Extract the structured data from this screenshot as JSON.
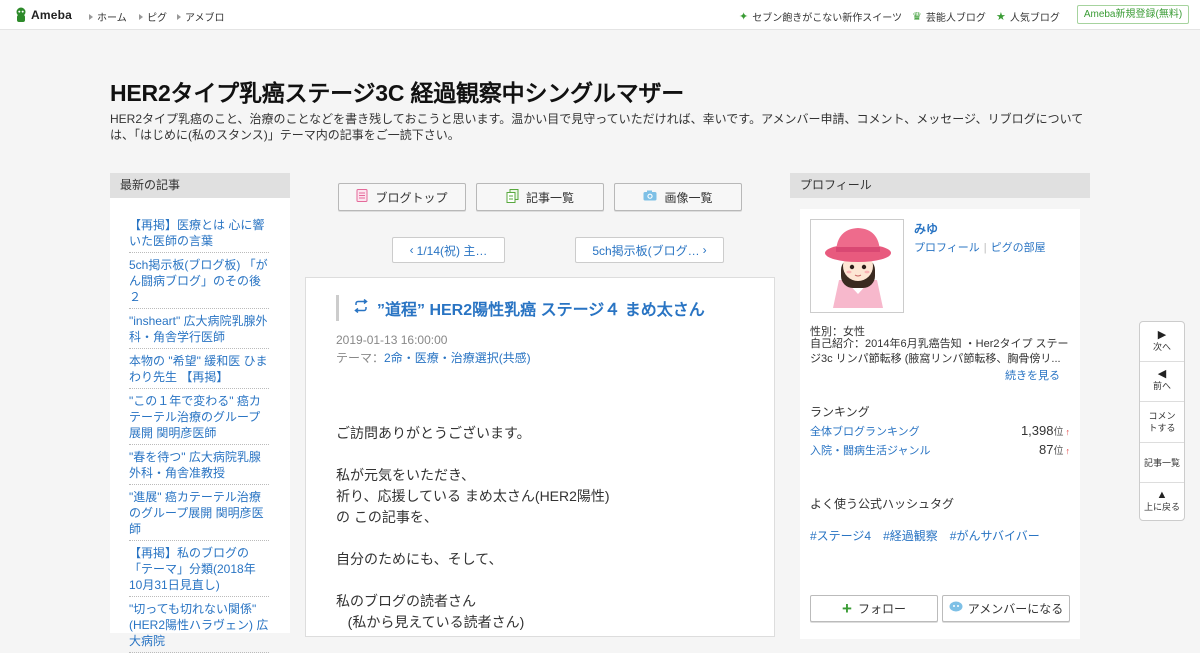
{
  "header": {
    "logo_text": "Ameba",
    "nav": [
      "ホーム",
      "ピグ",
      "アメブロ"
    ],
    "right_links": [
      {
        "icon": "sparkle-icon",
        "label": "セブン飽きがこない新作スイーツ"
      },
      {
        "icon": "crown-icon",
        "label": "芸能人ブログ"
      },
      {
        "icon": "star-icon",
        "label": "人気ブログ"
      }
    ],
    "signup_label": "Ameba新規登録(無料)"
  },
  "blog": {
    "title": "HER2タイプ乳癌ステージ3C 経過観察中シングルマザー",
    "description": "HER2タイプ乳癌のこと、治療のことなどを書き残しておこうと思います。温かい目で見守っていただければ、幸いです。アメンバー申請、コメント、メッセージ、リブログについては、「はじめに(私のスタンス)」テーマ内の記事をご一読下さい。"
  },
  "recent": {
    "heading": "最新の記事",
    "items": [
      "【再掲】医療とは 心に響いた医師の言葉",
      "5ch掲示板(ブログ板) 「がん闘病ブログ」のその後２",
      "\"insheart\" 広大病院乳腺外科・角舎学行医師",
      "本物の \"希望\" 緩和医 ひまわり先生 【再掲】",
      "\"この１年で変わる\" 癌カテーテル治療のグループ展開 関明彦医師",
      "\"春を待つ\" 広大病院乳腺外科・角舎准教授",
      "\"進展\" 癌カテーテル治療のグループ展開 関明彦医師",
      "【再掲】私のブログの「テーマ」分類(2018年10月31日見直し)",
      "\"切っても切れない関係\" (HER2陽性ハラヴェン) 広大病院"
    ]
  },
  "tabs": [
    {
      "icon": "notebook-icon",
      "label": "ブログトップ"
    },
    {
      "icon": "documents-icon",
      "label": "記事一覧"
    },
    {
      "icon": "camera-icon",
      "label": "画像一覧"
    }
  ],
  "pager": {
    "prev": "1/14(祝) 主…",
    "next": "5ch掲示板(ブログ…"
  },
  "article": {
    "title": "”道程” HER2陽性乳癌 ステージ４ まめ太さん",
    "date": "2019-01-13 16:00:00",
    "theme_label": "テーマ：",
    "theme": "2命・医療・治療選択(共感)",
    "body": [
      "ご訪問ありがとうございます。",
      "",
      "私が元気をいただき、",
      "祈り、応援している まめ太さん(HER2陽性)",
      "の この記事を、",
      "",
      "自分のためにも、そして、",
      "",
      "私のブログの読者さん",
      "   (私から見えている読者さん)"
    ]
  },
  "profile": {
    "heading": "プロフィール",
    "name": "みゆ",
    "link_profile": "プロフィール",
    "link_pig": "ピグの部屋",
    "sex": "性別：女性",
    "intro": "自己紹介：2014年6月乳癌告知 ・Her2タイプ ステージ3c リンパ節転移 (腋窩リンパ節転移、胸骨傍リ...",
    "more": "続きを見る",
    "ranking_heading": "ランキング",
    "rankings": [
      {
        "name": "全体ブログランキング",
        "value": "1,398",
        "unit": "位",
        "trend": "↑"
      },
      {
        "name": "入院・闘病生活ジャンル",
        "value": "87",
        "unit": "位",
        "trend": "↑"
      }
    ],
    "hashtag_heading": "よく使う公式ハッシュタグ",
    "hashtags": [
      "#ステージ4",
      "#経過観察",
      "#がんサバイバー"
    ],
    "follow_label": "フォロー",
    "amember_label": "アメンバーになる"
  },
  "sidenav": {
    "next": "次へ",
    "prev": "前へ",
    "comment": "コメントする",
    "list": "記事一覧",
    "top": "上に戻る"
  },
  "colors": {
    "link": "#2974c3",
    "ameba_green": "#3a9c35",
    "column_header": "#e0e0e0"
  }
}
